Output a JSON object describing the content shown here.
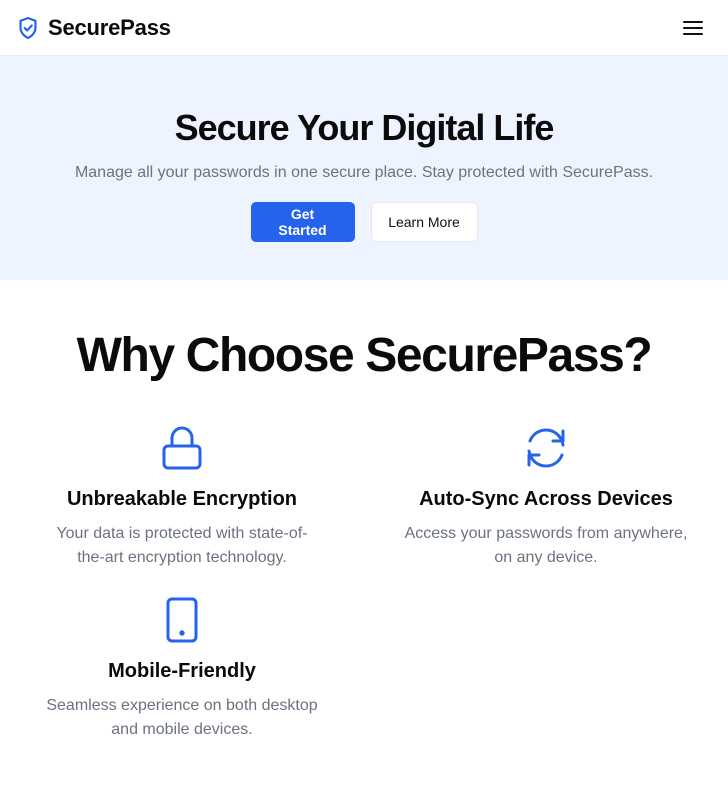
{
  "header": {
    "brand": "SecurePass",
    "logo_icon": "shield-check-icon",
    "menu_icon": "hamburger-menu-icon"
  },
  "hero": {
    "title": "Secure Your Digital Life",
    "subtitle": "Manage all your passwords in one secure place. Stay protected with SecurePass.",
    "primary_cta": "Get Started",
    "secondary_cta": "Learn More"
  },
  "features": {
    "heading": "Why Choose SecurePass?",
    "items": [
      {
        "icon": "lock-icon",
        "title": "Unbreakable Encryption",
        "description": "Your data is protected with state-of-the-art encryption technology."
      },
      {
        "icon": "sync-icon",
        "title": "Auto-Sync Across Devices",
        "description": "Access your passwords from anywhere, on any device."
      },
      {
        "icon": "mobile-icon",
        "title": "Mobile-Friendly",
        "description": "Seamless experience on both desktop and mobile devices."
      }
    ]
  },
  "colors": {
    "accent": "#2563eb",
    "hero_bg": "#eef4ff",
    "muted_text": "#6b7280"
  }
}
